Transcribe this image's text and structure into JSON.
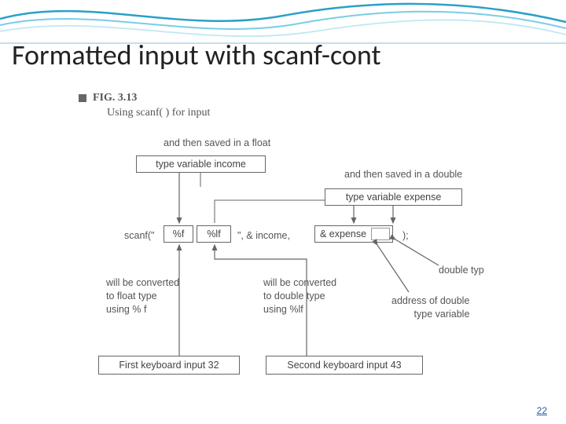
{
  "slide": {
    "title": "Formatted input with scanf-cont",
    "page_number": "22"
  },
  "figure": {
    "caption_id": "FIG. 3.13",
    "caption_text": "Using scanf( ) for input",
    "labels": {
      "saved_float": "and then saved in a float",
      "type_var_income": "type variable income",
      "saved_double": "and then saved in a double",
      "type_var_expense": "type variable expense",
      "scanf_open": "scanf(\"",
      "fmt_f": "%f",
      "fmt_lf": "%lf",
      "mid_quote": "\", & income,",
      "amp_expense": "& expense",
      "close_paren": ");",
      "double_typ": "double typ",
      "conv_float": "will be converted\nto float type\nusing % f",
      "conv_double": "will be converted\nto double type\nusing %lf",
      "addr_double": "address of double\ntype variable",
      "first_input": "First keyboard input 32",
      "second_input": "Second keyboard input 43"
    }
  },
  "chart_data": {
    "type": "diagram",
    "title": "Using scanf( ) for input",
    "nodes": [
      {
        "id": "kb1",
        "text": "First keyboard input 32"
      },
      {
        "id": "kb2",
        "text": "Second keyboard input 43"
      },
      {
        "id": "fmt_f",
        "text": "%f"
      },
      {
        "id": "fmt_lf",
        "text": "%lf"
      },
      {
        "id": "income_box",
        "text": "type variable income"
      },
      {
        "id": "expense_box",
        "text": "type variable expense"
      },
      {
        "id": "amp_expense_box",
        "text": "& expense"
      }
    ],
    "edges": [
      {
        "from": "kb1",
        "to": "fmt_f",
        "label": "will be converted to float type using % f"
      },
      {
        "from": "kb2",
        "to": "fmt_lf",
        "label": "will be converted to double type using %lf"
      },
      {
        "from": "fmt_f",
        "to": "income_box",
        "label": "and then saved in a float"
      },
      {
        "from": "fmt_lf",
        "to": "expense_box",
        "label": "and then saved in a double"
      },
      {
        "from": "amp_expense_box",
        "to": "addr_label",
        "label": "address of double type variable / double typ"
      }
    ]
  }
}
